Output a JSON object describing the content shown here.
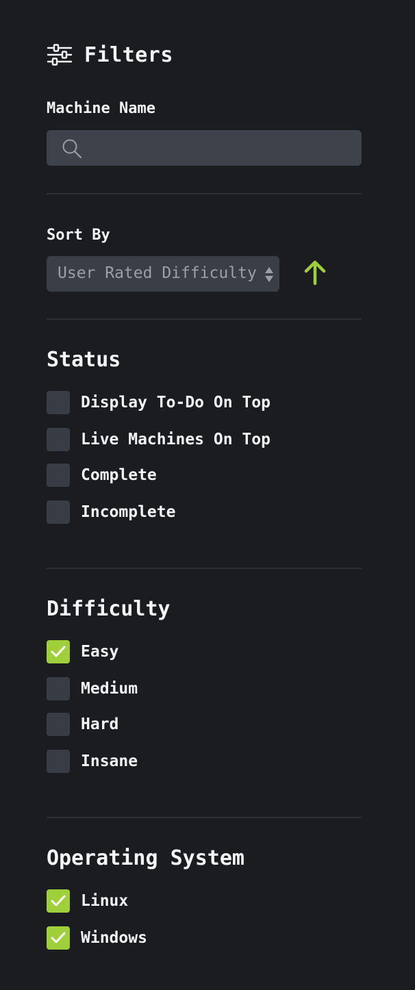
{
  "header": {
    "title": "Filters",
    "icon": "sliders-icon"
  },
  "machine_name": {
    "label": "Machine Name",
    "value": "",
    "icon": "search-icon"
  },
  "sort": {
    "label": "Sort By",
    "selected": "User Rated Difficulty",
    "direction_icon": "arrow-up-icon",
    "accent": "#9fcf3a"
  },
  "status": {
    "title": "Status",
    "options": [
      {
        "label": "Display To-Do On Top",
        "checked": false
      },
      {
        "label": "Live Machines On Top",
        "checked": false
      },
      {
        "label": "Complete",
        "checked": false
      },
      {
        "label": "Incomplete",
        "checked": false
      }
    ]
  },
  "difficulty": {
    "title": "Difficulty",
    "options": [
      {
        "label": "Easy",
        "checked": true
      },
      {
        "label": "Medium",
        "checked": false
      },
      {
        "label": "Hard",
        "checked": false
      },
      {
        "label": "Insane",
        "checked": false
      }
    ]
  },
  "os": {
    "title": "Operating System",
    "options": [
      {
        "label": "Linux",
        "checked": true
      },
      {
        "label": "Windows",
        "checked": true
      }
    ]
  },
  "colors": {
    "background": "#1b1c20",
    "checked": "#9fcf3a",
    "unchecked": "#383c44",
    "input": "#3d424b"
  }
}
